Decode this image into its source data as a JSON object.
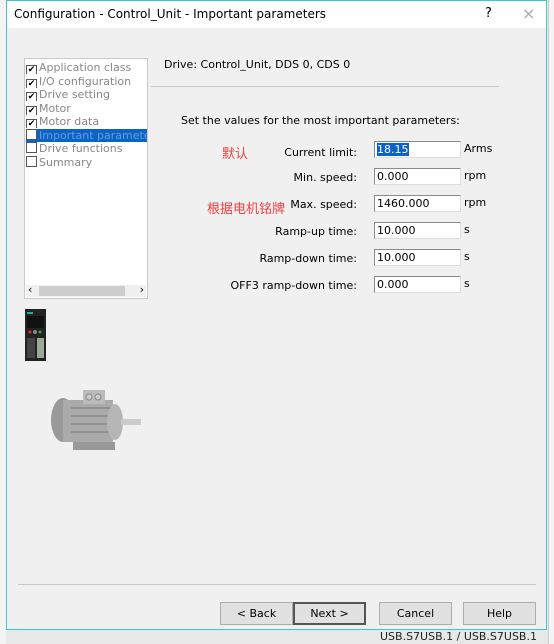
{
  "window": {
    "title": "Configuration - Control_Unit - Important parameters",
    "help_label": "?",
    "close_label": "×"
  },
  "tree": {
    "items": [
      {
        "label": "Application class",
        "checked": true
      },
      {
        "label": "I/O configuration",
        "checked": true
      },
      {
        "label": "Drive setting",
        "checked": true
      },
      {
        "label": "Motor",
        "checked": true
      },
      {
        "label": "Motor data",
        "checked": true
      },
      {
        "label": "Important parameters",
        "checked": false,
        "selected": true
      },
      {
        "label": "Drive functions",
        "checked": false
      },
      {
        "label": "Summary",
        "checked": false
      }
    ],
    "scroll_left": "‹",
    "scroll_right": "›"
  },
  "main": {
    "drive_header": "Drive: Control_Unit, DDS 0, CDS 0",
    "intro": "Set the values for the most important parameters:",
    "params": [
      {
        "label": "Current limit:",
        "value": "18.15",
        "unit": "Arms"
      },
      {
        "label": "Min. speed:",
        "value": "0.000",
        "unit": "rpm"
      },
      {
        "label": "Max. speed:",
        "value": "1460.000",
        "unit": "rpm"
      },
      {
        "label": "Ramp-up time:",
        "value": "10.000",
        "unit": "s"
      },
      {
        "label": "Ramp-down time:",
        "value": "10.000",
        "unit": "s"
      },
      {
        "label": "OFF3 ramp-down time:",
        "value": "0.000",
        "unit": "s"
      }
    ],
    "notes": {
      "default": "默认",
      "nameplate": "根据电机铭牌"
    },
    "accent": "#f04040"
  },
  "buttons": {
    "back": "< Back",
    "next": "Next >",
    "cancel": "Cancel",
    "help": "Help"
  },
  "background": {
    "status_text": "USB.S7USB.1 / USB.S7USB.1"
  }
}
